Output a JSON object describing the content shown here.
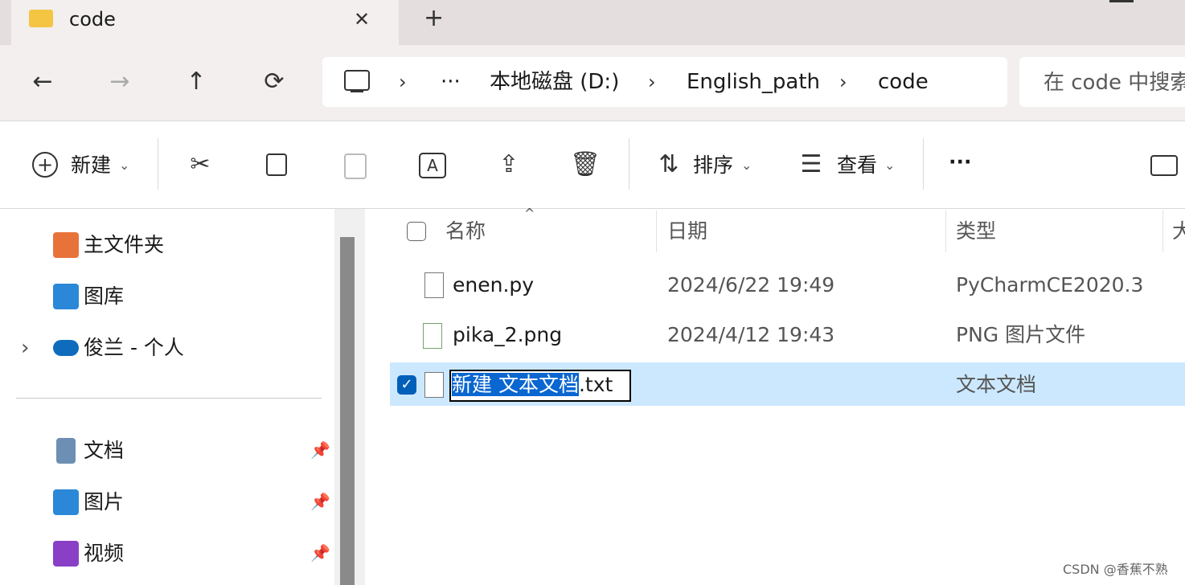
{
  "tab": {
    "title": "code",
    "close": "✕",
    "new_tab": "+"
  },
  "nav": {
    "back": "←",
    "forward": "→",
    "up": "↑",
    "refresh": "⟳",
    "breadcrumbs": [
      "本地磁盘 (D:)",
      "English_path",
      "code"
    ],
    "overflow": "···",
    "chevron": "›",
    "search_placeholder": "在 code 中搜索"
  },
  "toolbar": {
    "new_label": "新建",
    "sort_label": "排序",
    "view_label": "查看",
    "more": "···",
    "dropdown": "⌄"
  },
  "sidebar": {
    "items": [
      {
        "label": "主文件夹",
        "icon": "home-icon"
      },
      {
        "label": "图库",
        "icon": "gallery-icon"
      },
      {
        "label": "俊兰 - 个人",
        "icon": "onedrive-icon",
        "expand": "›"
      },
      {
        "label": "文档",
        "icon": "documents-icon",
        "pinned": true
      },
      {
        "label": "图片",
        "icon": "pictures-icon",
        "pinned": true
      },
      {
        "label": "视频",
        "icon": "videos-icon",
        "pinned": true
      }
    ],
    "pin_glyph": "📌"
  },
  "table": {
    "columns": [
      "名称",
      "日期",
      "类型",
      "大"
    ],
    "sort_indicator": "^",
    "rows": [
      {
        "name": "enen.py",
        "date": "2024/6/22 19:49",
        "type": "PyCharmCE2020.3"
      },
      {
        "name": "pika_2.png",
        "date": "2024/4/12 19:43",
        "type": "PNG 图片文件"
      },
      {
        "name_selected_part": "新建 文本文档",
        "name_ext": ".txt",
        "date": "",
        "type": "文本文档",
        "selected": true,
        "renaming": true
      }
    ]
  },
  "watermark": "CSDN @香蕉不熟",
  "colors": {
    "selection": "#cce8ff",
    "accent": "#005fb8",
    "tabbar": "#e4dede",
    "navbar": "#f3efef"
  }
}
